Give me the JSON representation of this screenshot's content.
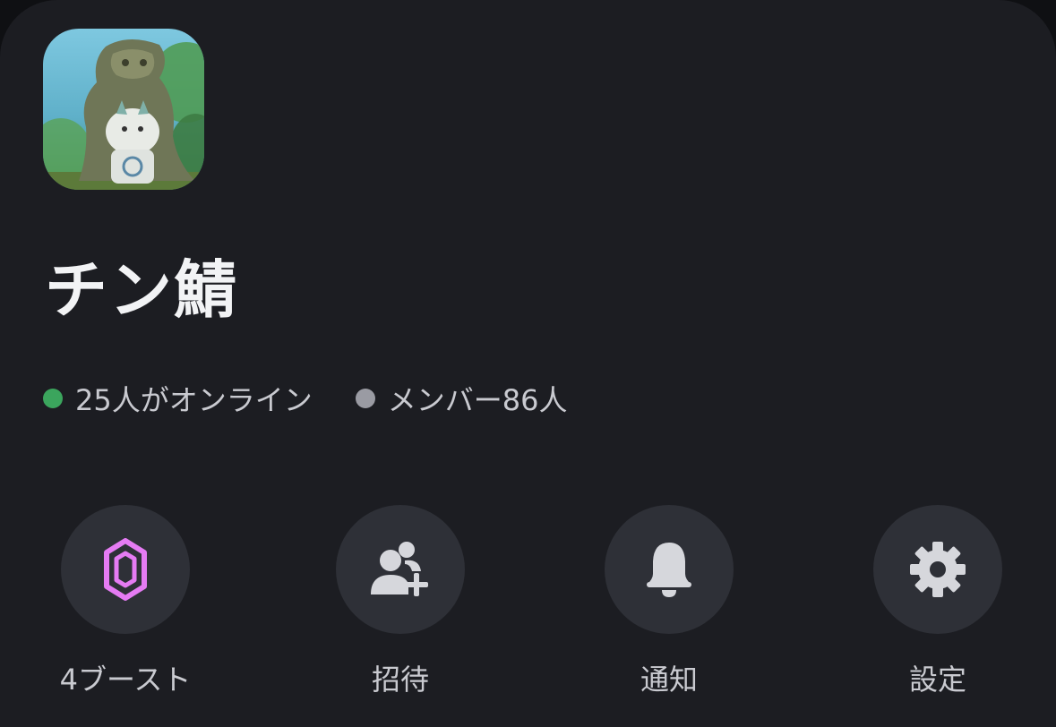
{
  "server": {
    "name": "チン鯖"
  },
  "stats": {
    "online_text": "25人がオンライン",
    "members_text": "メンバー86人",
    "online_color": "#3ba55d",
    "members_color": "#9a9ba3"
  },
  "actions": [
    {
      "label": "4ブースト",
      "icon": "boost-gem-icon",
      "icon_color": "#e57bf3"
    },
    {
      "label": "招待",
      "icon": "add-user-icon",
      "icon_color": "#d6d7dc"
    },
    {
      "label": "通知",
      "icon": "bell-icon",
      "icon_color": "#d6d7dc"
    },
    {
      "label": "設定",
      "icon": "gear-icon",
      "icon_color": "#d6d7dc"
    }
  ],
  "theme": {
    "background": "#1c1d22",
    "button_background": "#2e3037"
  }
}
